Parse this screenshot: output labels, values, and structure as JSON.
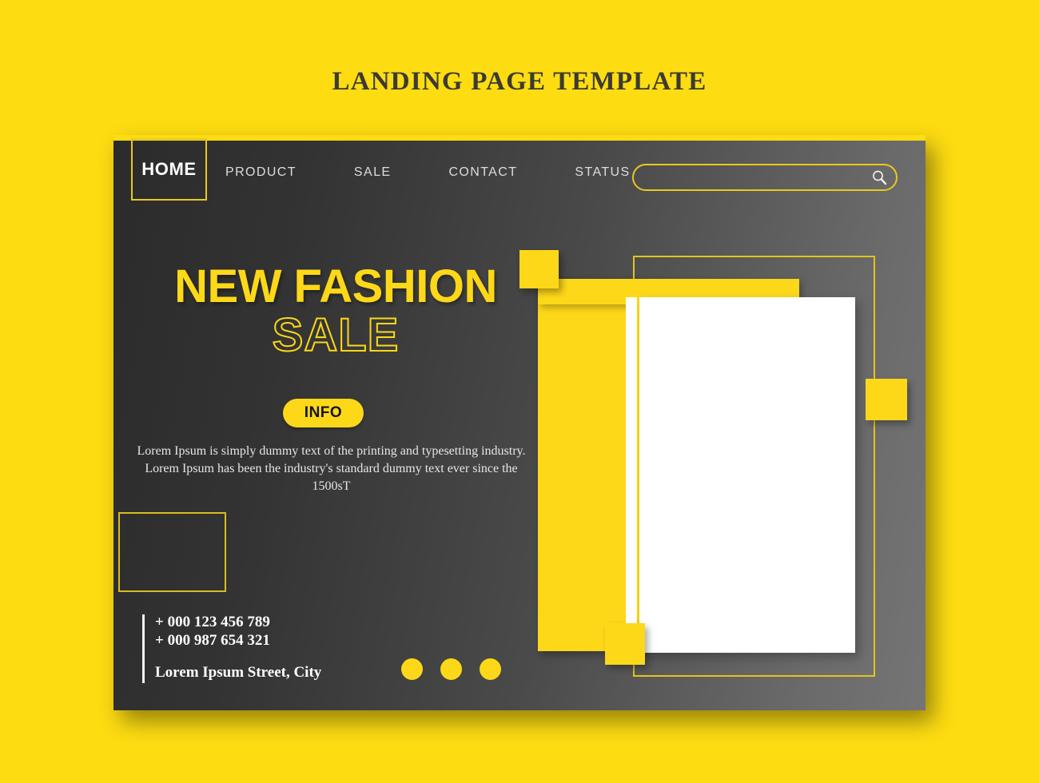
{
  "page": {
    "title": "LANDING PAGE TEMPLATE",
    "background_color": "#FDDC12",
    "accent_color": "#FDD819",
    "card_dark_color": "#2B2B2B"
  },
  "nav": {
    "active": "HOME",
    "links": [
      {
        "label": "PRODUCT"
      },
      {
        "label": "SALE"
      },
      {
        "label": "CONTACT"
      },
      {
        "label": "STATUS"
      }
    ]
  },
  "search": {
    "value": "",
    "placeholder": "",
    "icon": "search-icon"
  },
  "hero": {
    "headline_line1": "NEW FASHION",
    "headline_line2": "SALE",
    "cta_label": "INFO",
    "body": "Lorem Ipsum is simply dummy text of the printing and typesetting industry. Lorem Ipsum has been the industry's standard dummy text ever since the 1500sT"
  },
  "contact": {
    "phone_1": "+ 000 123 456 789",
    "phone_2": "+ 000 987 654 321",
    "address": "Lorem Ipsum Street, City"
  },
  "dots": [
    {
      "name": "dot-1"
    },
    {
      "name": "dot-2"
    },
    {
      "name": "dot-3"
    }
  ]
}
